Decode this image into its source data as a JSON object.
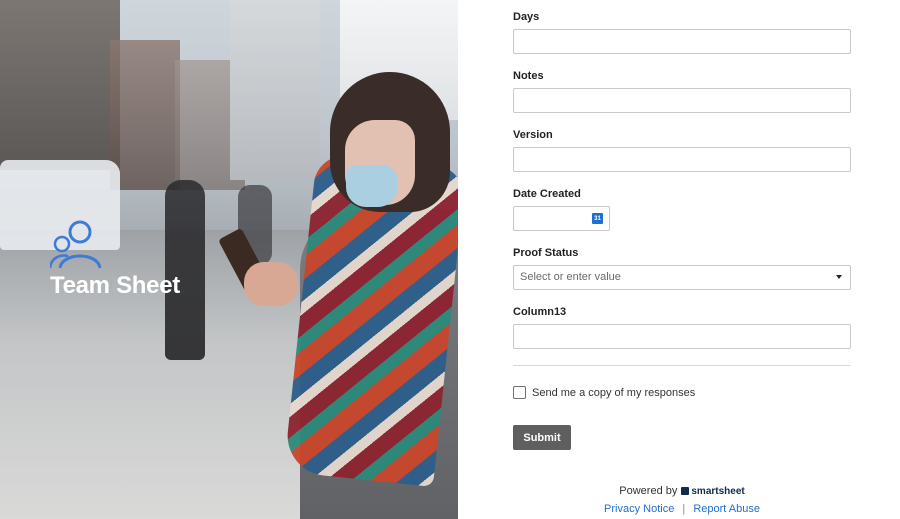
{
  "brand": {
    "name": "Team Sheet",
    "icon": "people-icon",
    "accent": "#3d7bd6"
  },
  "form": {
    "fields": [
      {
        "label": "Days",
        "value": ""
      },
      {
        "label": "Notes",
        "value": ""
      },
      {
        "label": "Version",
        "value": ""
      },
      {
        "label": "Date Created",
        "value": ""
      },
      {
        "label": "Proof Status",
        "placeholder": "Select or enter value"
      },
      {
        "label": "Column13",
        "value": ""
      }
    ],
    "calendar_icon_text": "31",
    "copy_label": "Send me a copy of my responses",
    "copy_checked": false,
    "submit_label": "Submit",
    "submit_color": "#5f5f5f"
  },
  "footer": {
    "powered_by": "Powered by",
    "logo_text": "smartsheet",
    "privacy": "Privacy Notice",
    "separator": "|",
    "report": "Report Abuse",
    "link_color": "#1f6fd1"
  }
}
